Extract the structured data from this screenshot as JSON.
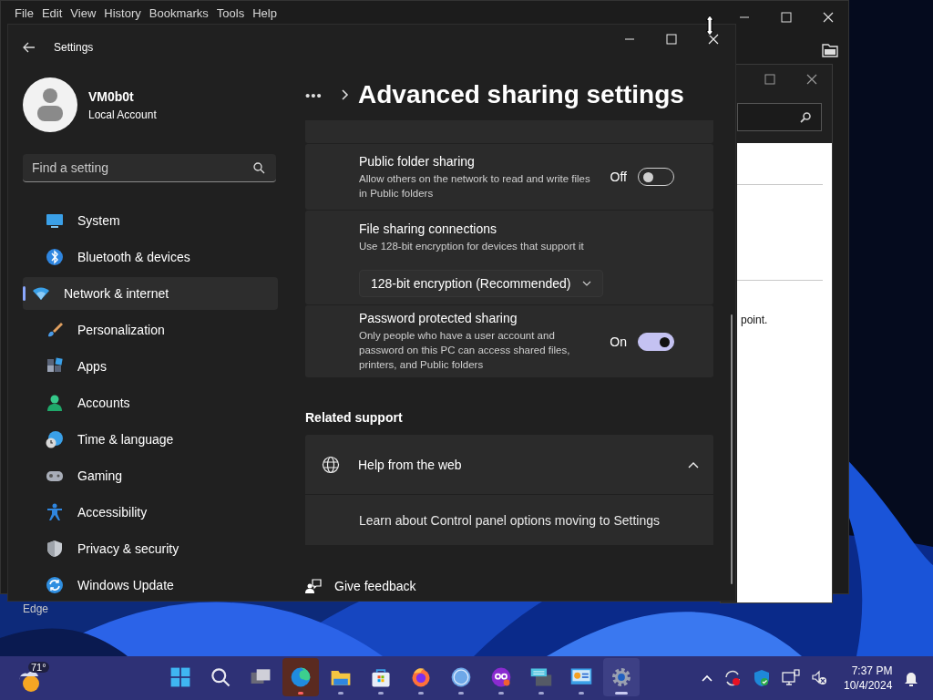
{
  "browser_window": {
    "menu": [
      "File",
      "Edit",
      "View",
      "History",
      "Bookmarks",
      "Tools",
      "Help"
    ]
  },
  "control_panel_window": {
    "body_text": "point."
  },
  "desktop": {
    "icon_label": "Edge"
  },
  "settings": {
    "title": "Settings",
    "account": {
      "name": "VM0b0t",
      "type": "Local Account"
    },
    "search": {
      "placeholder": "Find a setting"
    },
    "nav": [
      {
        "label": "System",
        "selected": false
      },
      {
        "label": "Bluetooth & devices",
        "selected": false
      },
      {
        "label": "Network & internet",
        "selected": true
      },
      {
        "label": "Personalization",
        "selected": false
      },
      {
        "label": "Apps",
        "selected": false
      },
      {
        "label": "Accounts",
        "selected": false
      },
      {
        "label": "Time & language",
        "selected": false
      },
      {
        "label": "Gaming",
        "selected": false
      },
      {
        "label": "Accessibility",
        "selected": false
      },
      {
        "label": "Privacy & security",
        "selected": false
      },
      {
        "label": "Windows Update",
        "selected": false
      }
    ],
    "breadcrumb": {
      "more": "•••",
      "title": "Advanced sharing settings"
    },
    "rows": [
      {
        "kind": "toggle",
        "title": "Public folder sharing",
        "description": "Allow others on the network to read and write files in Public folders",
        "state_label": "Off",
        "on": false
      },
      {
        "kind": "dropdown",
        "title": "File sharing connections",
        "description": "Use 128-bit encryption for devices that support it",
        "value": "128-bit encryption (Recommended)"
      },
      {
        "kind": "toggle",
        "title": "Password protected sharing",
        "description": "Only people who have a user account and password on this PC can access shared files, printers, and Public folders",
        "state_label": "On",
        "on": true
      }
    ],
    "related_support": {
      "heading": "Related support",
      "help": {
        "title": "Help from the web",
        "expanded": true,
        "links": [
          "Learn about Control panel options moving to Settings"
        ]
      }
    },
    "feedback": "Give feedback"
  },
  "taskbar": {
    "weather": "71°",
    "apps": [
      {
        "kind": "start",
        "running": false,
        "selected": false,
        "attention": false
      },
      {
        "kind": "search",
        "running": false,
        "selected": false,
        "attention": false
      },
      {
        "kind": "taskview",
        "running": false,
        "selected": false,
        "attention": false
      },
      {
        "kind": "edge",
        "running": true,
        "selected": false,
        "attention": true
      },
      {
        "kind": "explorer",
        "running": true,
        "selected": false,
        "attention": false
      },
      {
        "kind": "store",
        "running": true,
        "selected": false,
        "attention": false
      },
      {
        "kind": "firefox",
        "running": true,
        "selected": false,
        "attention": false
      },
      {
        "kind": "torrent",
        "running": true,
        "selected": false,
        "attention": false
      },
      {
        "kind": "infinity",
        "running": true,
        "selected": false,
        "attention": false
      },
      {
        "kind": "keyboard",
        "running": true,
        "selected": false,
        "attention": false
      },
      {
        "kind": "controlpanel",
        "running": true,
        "selected": false,
        "attention": false
      },
      {
        "kind": "settings",
        "running": true,
        "selected": true,
        "attention": false
      }
    ],
    "time": "7:37 PM",
    "date": "10/4/2024"
  }
}
